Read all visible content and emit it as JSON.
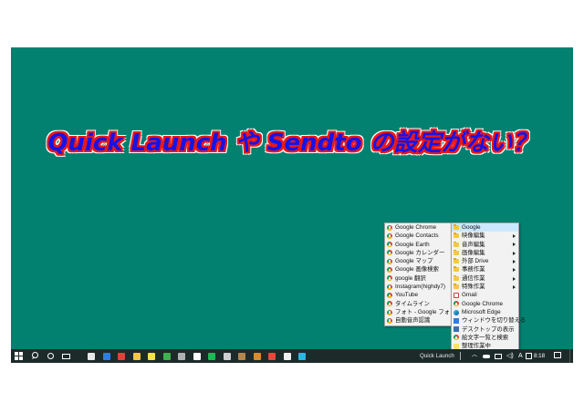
{
  "headline": "Quick Launch や Sendto の設定がない？",
  "left_menu": {
    "items": [
      {
        "label": "Google Chrome",
        "icon": "chrome-icon"
      },
      {
        "label": "Google Contacts",
        "icon": "chrome-icon"
      },
      {
        "label": "Google Earth",
        "icon": "chrome-icon"
      },
      {
        "label": "Google カレンダー",
        "icon": "chrome-icon"
      },
      {
        "label": "Google マップ",
        "icon": "chrome-icon"
      },
      {
        "label": "Google 画像検索",
        "icon": "chrome-icon"
      },
      {
        "label": "google 翻訳",
        "icon": "chrome-icon"
      },
      {
        "label": "Instagram(highdy7)",
        "icon": "chrome-icon"
      },
      {
        "label": "YouTube",
        "icon": "chrome-icon"
      },
      {
        "label": "タイムライン",
        "icon": "chrome-icon"
      },
      {
        "label": "フォト - Google フォト",
        "icon": "chrome-icon"
      },
      {
        "label": "自動音声認識",
        "icon": "chrome-icon"
      }
    ]
  },
  "right_menu": {
    "items": [
      {
        "label": "Google",
        "icon": "folder-icon",
        "submenu": false,
        "selected": true
      },
      {
        "label": "映像編集",
        "icon": "folder-icon",
        "submenu": true
      },
      {
        "label": "音声編集",
        "icon": "folder-icon",
        "submenu": true
      },
      {
        "label": "画像編集",
        "icon": "folder-icon",
        "submenu": true
      },
      {
        "label": "外部 Drive",
        "icon": "folder-icon",
        "submenu": true
      },
      {
        "label": "事務作業",
        "icon": "folder-icon",
        "submenu": true
      },
      {
        "label": "通信作業",
        "icon": "folder-icon",
        "submenu": true
      },
      {
        "label": "特殊作業",
        "icon": "folder-icon",
        "submenu": true
      },
      {
        "label": "Gmail",
        "icon": "gmail-icon",
        "submenu": false
      },
      {
        "label": "Google Chrome",
        "icon": "chrome-icon",
        "submenu": false
      },
      {
        "label": "Microsoft Edge",
        "icon": "edge-icon",
        "submenu": false
      },
      {
        "label": "ウィンドウを切り替える",
        "icon": "window-switch-icon",
        "submenu": false
      },
      {
        "label": "デスクトップの表示",
        "icon": "show-desktop-icon",
        "submenu": false
      },
      {
        "label": "絵文字一覧と検索",
        "icon": "chrome-icon",
        "submenu": false
      },
      {
        "label": "整理作業中",
        "icon": "note-icon",
        "submenu": false
      }
    ]
  },
  "taskbar": {
    "quick_launch_label": "Quick Launch",
    "clock": "8:18",
    "ime_label": "A",
    "app_colors": [
      "#e8e8e8",
      "#2d7de2",
      "#db4437",
      "#f6c744",
      "#f4e04d",
      "#3ab54a",
      "#b0b0b0",
      "#ffffff",
      "#1db954",
      "#cfcfcf",
      "#b3864d",
      "#d88a2e",
      "#e04b3a",
      "#f0f0f0",
      "#2db7e0"
    ]
  }
}
